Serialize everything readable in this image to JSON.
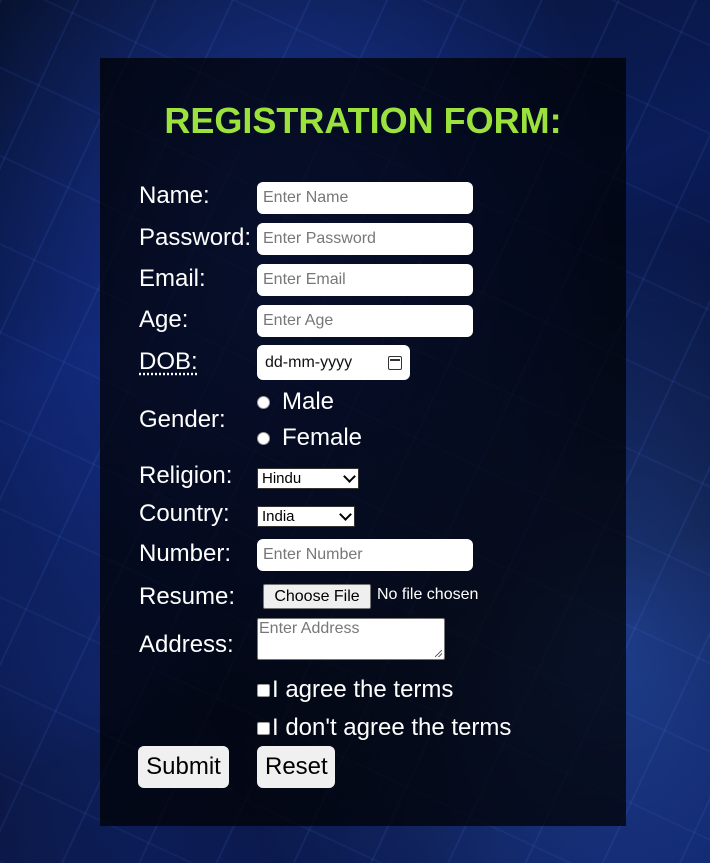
{
  "form": {
    "title": "REGISTRATION FORM:",
    "name": {
      "label": "Name:",
      "placeholder": "Enter Name"
    },
    "password": {
      "label": "Password:",
      "placeholder": "Enter Password"
    },
    "email": {
      "label": "Email:",
      "placeholder": "Enter Email"
    },
    "age": {
      "label": "Age:",
      "placeholder": "Enter Age"
    },
    "dob": {
      "label": "DOB:",
      "value": "dd-mm-yyyy"
    },
    "gender": {
      "label": "Gender:",
      "options": [
        "Male",
        "Female"
      ]
    },
    "religion": {
      "label": "Religion:",
      "selected": "Hindu"
    },
    "country": {
      "label": "Country:",
      "selected": "India"
    },
    "number": {
      "label": "Number:",
      "placeholder": "Enter Number"
    },
    "resume": {
      "label": "Resume:",
      "button": "Choose File",
      "status": "No file chosen"
    },
    "address": {
      "label": "Address:",
      "placeholder": "Enter Address"
    },
    "terms": {
      "agree": "I agree the terms",
      "disagree": "I don't agree the terms"
    },
    "submit": "Submit",
    "reset": "Reset"
  },
  "colors": {
    "title": "#9be33c",
    "panel": "rgba(0,0,0,0.72)"
  }
}
